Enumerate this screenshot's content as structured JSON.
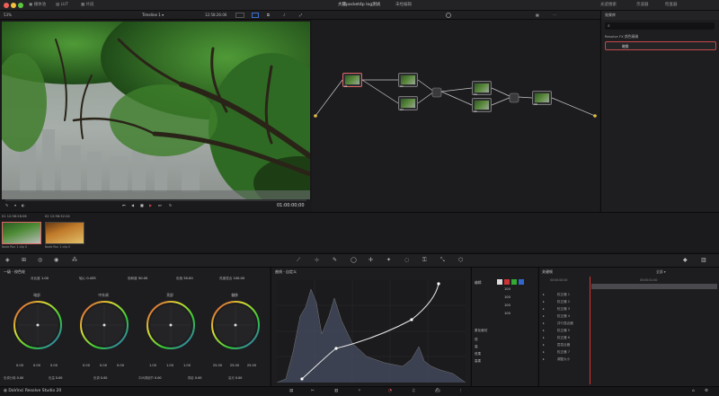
{
  "app": {
    "project_title": "大疆pocket4p log测试",
    "edited_label": "未经编辑",
    "media_pool": "媒体池",
    "lut": "LUT",
    "title_bar_right": [
      "光迹搜索",
      "示波器",
      "检查器"
    ],
    "library_label": "效果库"
  },
  "toolbar": {
    "zoom": "53%",
    "timeline_name": "Timeline 1",
    "timecode_top": "12:58:26:06",
    "clip_label": "片段"
  },
  "viewer": {
    "timecode": "01:00:00;00"
  },
  "right_panel": {
    "search_placeholder": "",
    "path_label": "Resolve FX 颜色精确",
    "selected_fx": "暗角"
  },
  "clips": [
    {
      "num": "01",
      "tc": "12:58:26:06",
      "name": "Node Run 1 clip 0"
    },
    {
      "num": "02",
      "tc": "12:58:32:24",
      "name": "Node Run 1 clip 0"
    }
  ],
  "nodes": [
    {
      "label": "01"
    },
    {
      "label": "02"
    },
    {
      "label": "03"
    },
    {
      "label": "04"
    },
    {
      "label": "05"
    },
    {
      "label": "06"
    }
  ],
  "wheels": {
    "panel_title": "一级 - 校色轮",
    "params": [
      {
        "label": "对比度",
        "value": "1.00"
      },
      {
        "label": "轴心",
        "value": "0.435"
      },
      {
        "label": "饱和度",
        "value": "50.00"
      },
      {
        "label": "色相",
        "value": "50.00"
      },
      {
        "label": "亮度混合",
        "value": "100.00"
      }
    ],
    "items": [
      {
        "title": "暗部",
        "v": [
          "0.00",
          "0.00",
          "0.00"
        ],
        "lum": "0.00"
      },
      {
        "title": "中灰调",
        "v": [
          "0.00",
          "0.00",
          "0.00"
        ],
        "lum": "0.00"
      },
      {
        "title": "亮部",
        "v": [
          "1.00",
          "1.00",
          "1.00"
        ],
        "lum": "1.00"
      },
      {
        "title": "偏移",
        "v": [
          "25.00",
          "25.00",
          "25.00"
        ],
        "lum": "25.00"
      }
    ],
    "bottom": [
      {
        "label": "色调分离",
        "value": "0.00"
      },
      {
        "label": "色温",
        "value": "0.00"
      },
      {
        "label": "色调",
        "value": "0.00"
      },
      {
        "label": "中间调细节",
        "value": "0.00"
      },
      {
        "label": "阴影",
        "value": "0.00"
      },
      {
        "label": "高光",
        "value": "0.00"
      }
    ]
  },
  "curves": {
    "panel_title": "曲线 - 自定义"
  },
  "curve_channels": {
    "title": "编辑",
    "rows": [
      {
        "label": "",
        "value": "100"
      },
      {
        "label": "",
        "value": "100"
      },
      {
        "label": "",
        "value": "100"
      },
      {
        "label": "",
        "value": "100"
      }
    ],
    "soft_label": "柔化裁切",
    "extra_labels": [
      "低",
      "高",
      "低柔",
      "高柔"
    ]
  },
  "keyframes": {
    "title": "关键帧",
    "mode": "全部",
    "tc1": "00:00:00:00",
    "tc2": "00:00:01:00",
    "rows": [
      "校正器 1",
      "校正器 2",
      "校正器 3",
      "校正器 4",
      "并行混合器",
      "校正器 5",
      "校正器 6",
      "层混合器",
      "校正器 7",
      "调整大小"
    ]
  },
  "pagebar": {
    "app_name": "DaVinci Resolve Studio 20",
    "pages": [
      "媒体",
      "快编",
      "剪辑",
      "Fusion",
      "调色",
      "Fairlight",
      "交付"
    ]
  },
  "colors": {
    "accent": "#c24a4a",
    "playhead": "#d33",
    "curve_line": "#e8e8e8"
  }
}
